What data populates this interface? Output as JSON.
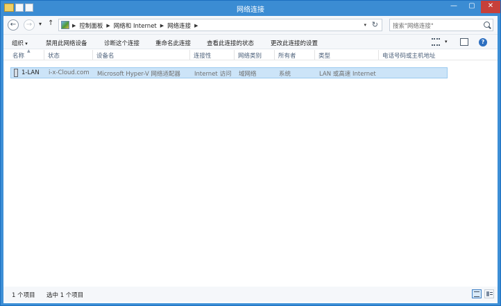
{
  "window": {
    "title": "网络连接",
    "min_label": "—",
    "max_label": "▢",
    "close_label": "✕"
  },
  "address": {
    "breadcrumbs": [
      "控制面板",
      "网络和 Internet",
      "网络连接"
    ],
    "search_placeholder": "搜索\"网络连接\""
  },
  "commands": {
    "organize": "组织",
    "disable": "禁用此网络设备",
    "diagnose": "诊断这个连接",
    "rename": "重命名此连接",
    "view_status": "查看此连接的状态",
    "change_settings": "更改此连接的设置",
    "help": "?"
  },
  "columns": [
    "名称",
    "状态",
    "设备名",
    "连接性",
    "网络类别",
    "所有者",
    "类型",
    "电话号码或主机地址"
  ],
  "rows": [
    {
      "name": "1-LAN",
      "status": "i-x-Cloud.com",
      "device": "Microsoft Hyper-V 网络适配器",
      "connectivity": "Internet 访问",
      "category": "域网络",
      "owner": "系统",
      "type": "LAN 或高速 Internet",
      "phone": ""
    }
  ],
  "statusbar": {
    "count": "1 个项目",
    "selected": "选中 1 个项目"
  },
  "icons": [
    "back-arrow-icon",
    "forward-arrow-icon",
    "up-arrow-icon",
    "control-panel-icon",
    "refresh-icon",
    "search-icon",
    "view-options-icon",
    "preview-pane-icon",
    "help-icon",
    "network-adapter-icon",
    "details-view-icon",
    "tiles-view-icon"
  ]
}
